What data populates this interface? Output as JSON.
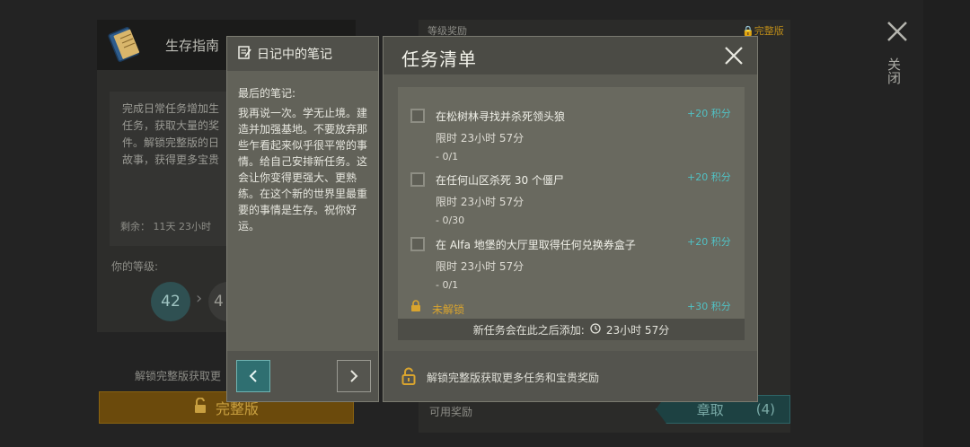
{
  "background": {
    "guide_title": "生存指南",
    "guide_desc": "完成日常任务增加生\n任务，获取大量的奖\n件。解锁完整版的日\n故事，获得更多宝贵",
    "remaining": "剩余： 11天 23小时",
    "level_label": "你的等级:",
    "level_current": "42",
    "level_next": "4",
    "unlock_text": "解锁完整版获取更",
    "full_version_button": "完整版",
    "level_rewards": "等级奖励",
    "full_version_tag": "完整版",
    "available_rewards": "可用奖励",
    "claim_button": "章取",
    "claim_count": "(4)",
    "close_label": "关闭"
  },
  "diary": {
    "title": "日记中的笔记",
    "intro": "最后的笔记:",
    "text": "我再说一次。学无止境。建造并加强基地。不要放弃那些乍看起来似乎很平常的事情。给自己安排新任务。这会让你变得更强大、更熟练。在这个新的世界里最重要的事情是生存。祝你好运。"
  },
  "tasks": {
    "title": "任务清单",
    "items": [
      {
        "name": "在松树林寻找并杀死领头狼",
        "time": "限时 23小时 57分",
        "progress": "- 0/1",
        "points": "+20 积分"
      },
      {
        "name": "在任何山区杀死 30 个僵尸",
        "time": "限时 23小时 57分",
        "progress": "- 0/30",
        "points": "+20 积分"
      },
      {
        "name": "在 Alfa 地堡的大厅里取得任何兑换券盒子",
        "time": "限时 23小时 57分",
        "progress": "- 0/1",
        "points": "+20 积分"
      }
    ],
    "locked_label": "未解锁",
    "locked_points": "+30 积分",
    "new_tasks_text": "新任务会在此之后添加:",
    "new_tasks_time": "23小时 57分",
    "footer_text": "解锁完整版获取更多任务和宝贵奖励"
  },
  "colors": {
    "accent_teal": "#51c1c4",
    "accent_gold": "#d9a42e"
  }
}
